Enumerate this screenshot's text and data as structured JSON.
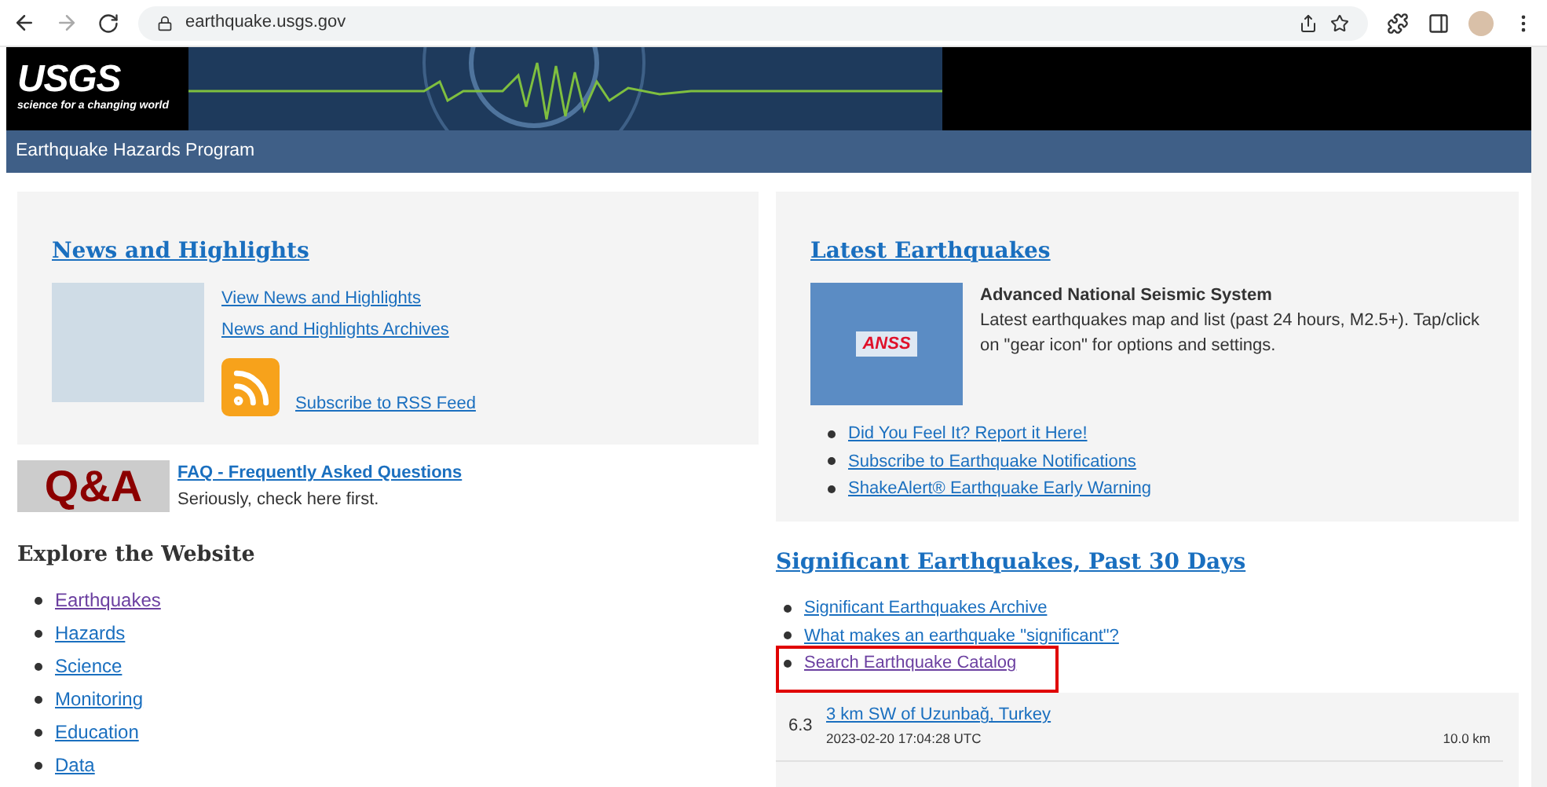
{
  "browser": {
    "url": "earthquake.usgs.gov"
  },
  "header": {
    "logo_text": "USGS",
    "tagline": "science for a changing world",
    "program": "Earthquake Hazards Program"
  },
  "news": {
    "title": "News and Highlights",
    "links": [
      {
        "label": "View News and Highlights",
        "visited": false
      },
      {
        "label": "News and Highlights Archives",
        "visited": false
      }
    ],
    "rss": "Subscribe to RSS Feed"
  },
  "faq": {
    "badge": "Q&A",
    "link": "FAQ - Frequently Asked Questions",
    "note": "Seriously, check here first."
  },
  "explore": {
    "title": "Explore the Website",
    "links": [
      {
        "label": "Earthquakes",
        "visited": true
      },
      {
        "label": "Hazards",
        "visited": false
      },
      {
        "label": "Science",
        "visited": false
      },
      {
        "label": "Monitoring",
        "visited": false
      },
      {
        "label": "Education",
        "visited": false
      },
      {
        "label": "Data",
        "visited": false
      }
    ]
  },
  "latest": {
    "title": "Latest Earthquakes",
    "map_label": "ANSS",
    "system": "Advanced National Seismic System",
    "description": "Latest earthquakes map and list (past 24 hours, M2.5+). Tap/click on \"gear icon\" for options and settings.",
    "links": [
      {
        "label": "Did You Feel It? Report it Here!",
        "visited": false
      },
      {
        "label": "Subscribe to Earthquake Notifications",
        "visited": false
      },
      {
        "label": "ShakeAlert® Earthquake Early Warning",
        "visited": false
      }
    ]
  },
  "significant": {
    "title": "Significant Earthquakes, Past 30 Days",
    "links": [
      {
        "label": "Significant Earthquakes Archive",
        "visited": false
      },
      {
        "label": "What makes an earthquake \"significant\"?",
        "visited": false
      },
      {
        "label": "Search Earthquake Catalog",
        "visited": true
      }
    ],
    "events": [
      {
        "magnitude": "6.3",
        "place": "3 km SW of Uzunbağ, Turkey",
        "time": "2023-02-20 17:04:28 UTC",
        "depth": "10.0 km"
      }
    ]
  }
}
